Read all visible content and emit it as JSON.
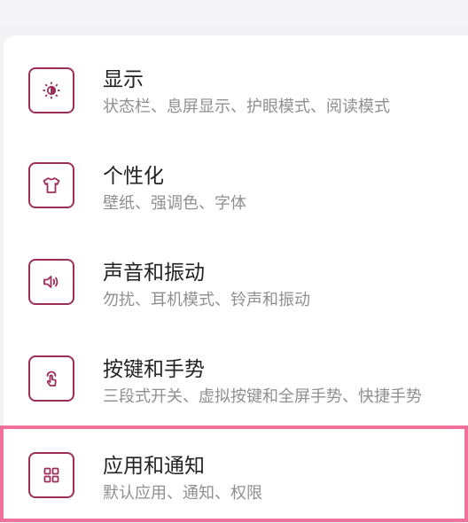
{
  "settings": {
    "items": [
      {
        "title": "显示",
        "subtitle": "状态栏、息屏显示、护眼模式、阅读模式",
        "icon": "display-brightness-icon"
      },
      {
        "title": "个性化",
        "subtitle": "壁纸、强调色、字体",
        "icon": "tshirt-icon"
      },
      {
        "title": "声音和振动",
        "subtitle": "勿扰、耳机模式、铃声和振动",
        "icon": "speaker-icon"
      },
      {
        "title": "按键和手势",
        "subtitle": "三段式开关、虚拟按键和全屏手势、快捷手势",
        "icon": "touch-gesture-icon"
      },
      {
        "title": "应用和通知",
        "subtitle": "默认应用、通知、权限",
        "icon": "apps-grid-icon"
      }
    ]
  },
  "colors": {
    "icon_accent": "#9c2e57",
    "highlight_border": "#f0729a",
    "title_text": "#222222",
    "subtitle_text": "#8f8f8f"
  }
}
